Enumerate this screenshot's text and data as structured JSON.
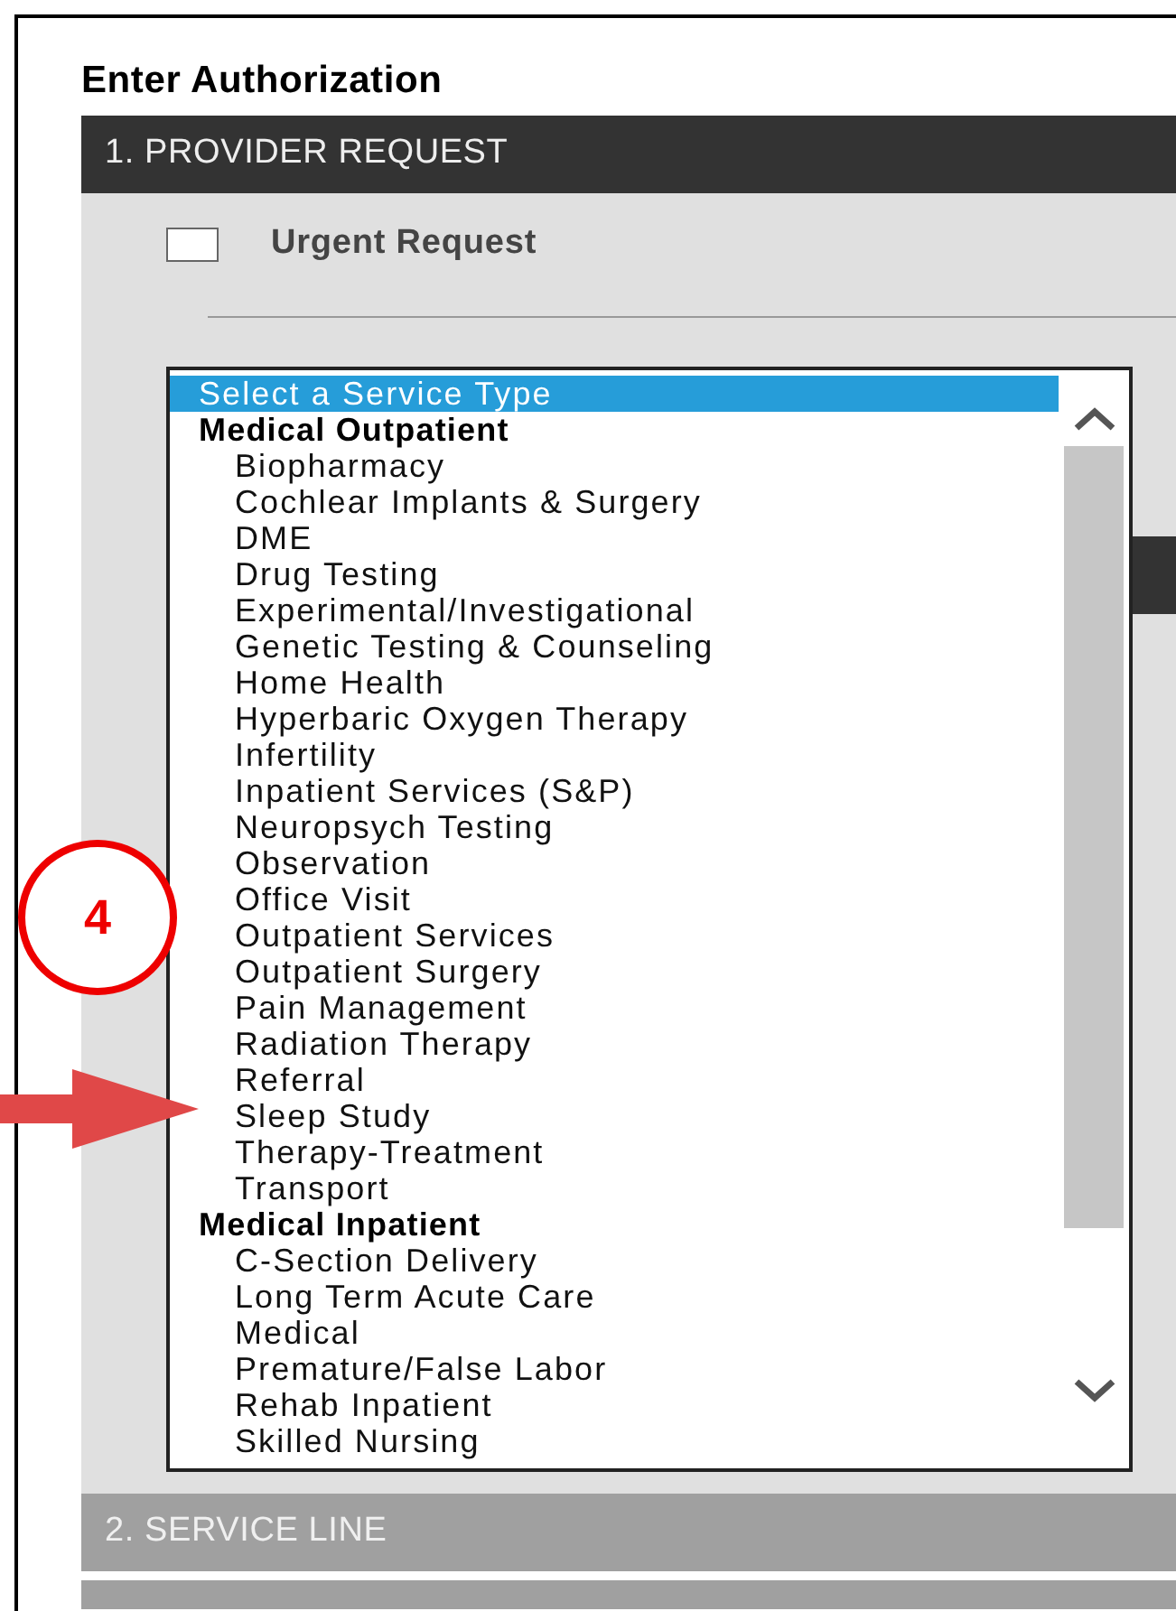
{
  "title": "Enter Authorization",
  "sections": [
    {
      "label": "1. PROVIDER REQUEST",
      "expanded": true
    },
    {
      "label": "2. SERVICE LINE",
      "expanded": false
    }
  ],
  "urgent": {
    "label": "Urgent Request",
    "checked": false
  },
  "service_list": {
    "options": [
      {
        "kind": "prompt",
        "label": "Select a Service Type",
        "selected": true
      },
      {
        "kind": "group",
        "label": "Medical Outpatient",
        "selected": false
      },
      {
        "kind": "option",
        "label": "Biopharmacy",
        "selected": false
      },
      {
        "kind": "option",
        "label": "Cochlear Implants & Surgery",
        "selected": false
      },
      {
        "kind": "option",
        "label": "DME",
        "selected": false
      },
      {
        "kind": "option",
        "label": "Drug Testing",
        "selected": false
      },
      {
        "kind": "option",
        "label": "Experimental/Investigational",
        "selected": false
      },
      {
        "kind": "option",
        "label": "Genetic Testing & Counseling",
        "selected": false
      },
      {
        "kind": "option",
        "label": "Home Health",
        "selected": false
      },
      {
        "kind": "option",
        "label": "Hyperbaric Oxygen Therapy",
        "selected": false
      },
      {
        "kind": "option",
        "label": "Infertility",
        "selected": false
      },
      {
        "kind": "option",
        "label": "Inpatient Services (S&P)",
        "selected": false
      },
      {
        "kind": "option",
        "label": "Neuropsych Testing",
        "selected": false
      },
      {
        "kind": "option",
        "label": "Observation",
        "selected": false
      },
      {
        "kind": "option",
        "label": "Office Visit",
        "selected": false
      },
      {
        "kind": "option",
        "label": "Outpatient Services",
        "selected": false
      },
      {
        "kind": "option",
        "label": "Outpatient Surgery",
        "selected": false
      },
      {
        "kind": "option",
        "label": "Pain Management",
        "selected": false
      },
      {
        "kind": "option",
        "label": "Radiation Therapy",
        "selected": false
      },
      {
        "kind": "option",
        "label": "Referral",
        "selected": false
      },
      {
        "kind": "option",
        "label": "Sleep Study",
        "selected": false
      },
      {
        "kind": "option",
        "label": "Therapy-Treatment",
        "selected": false
      },
      {
        "kind": "option",
        "label": "Transport",
        "selected": false
      },
      {
        "kind": "group",
        "label": "Medical Inpatient",
        "selected": false
      },
      {
        "kind": "option",
        "label": "C-Section Delivery",
        "selected": false
      },
      {
        "kind": "option",
        "label": "Long Term Acute Care",
        "selected": false
      },
      {
        "kind": "option",
        "label": "Medical",
        "selected": false
      },
      {
        "kind": "option",
        "label": "Premature/False Labor",
        "selected": false
      },
      {
        "kind": "option",
        "label": "Rehab Inpatient",
        "selected": false
      },
      {
        "kind": "option",
        "label": "Skilled Nursing",
        "selected": false
      }
    ]
  },
  "annotation": {
    "step": "4"
  }
}
